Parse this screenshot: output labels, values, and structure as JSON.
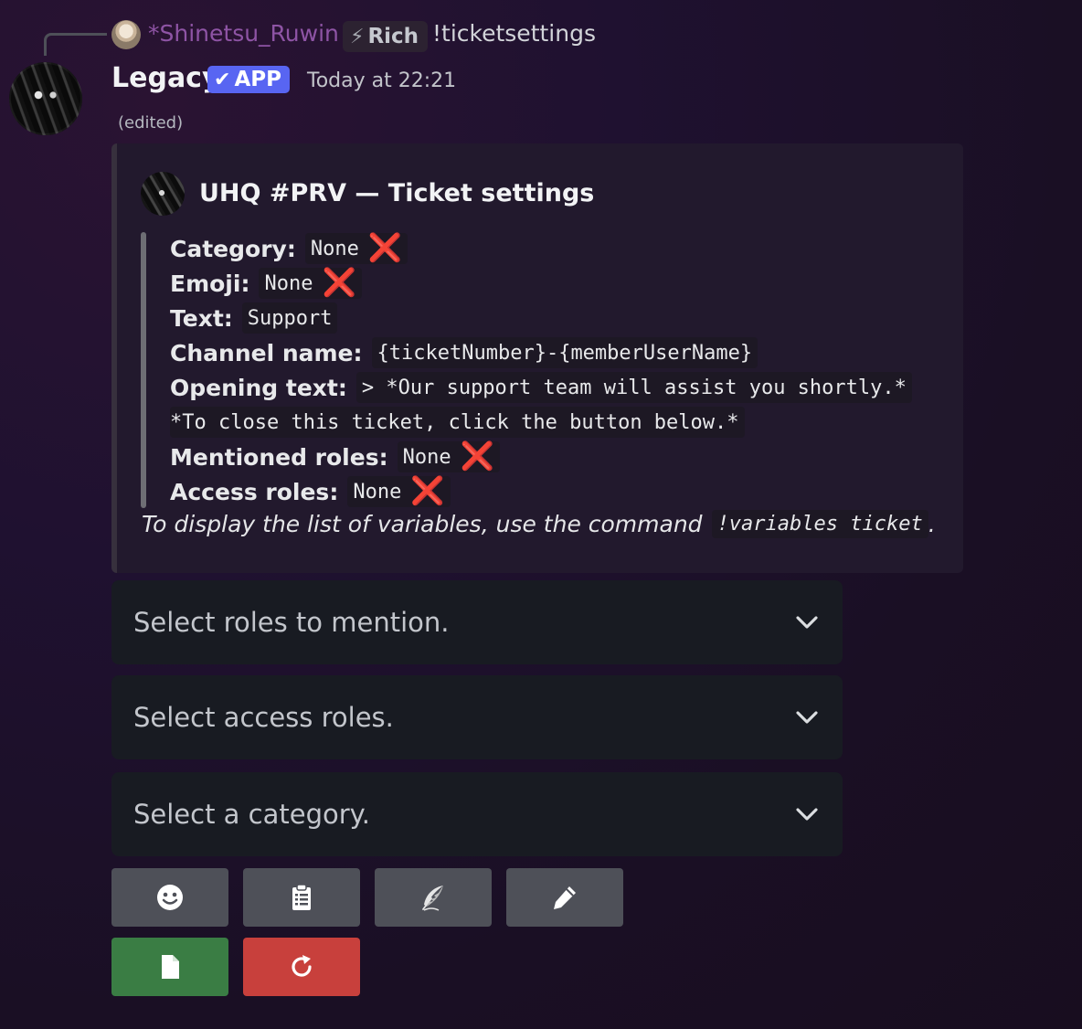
{
  "reply": {
    "username": "*Shinetsu_Ruwin",
    "tag": "Rich",
    "command": "!ticketsettings"
  },
  "message": {
    "author": "Legacy",
    "badge": "APP",
    "timestamp": "Today at 22:21",
    "edited": "(edited)"
  },
  "embed": {
    "title": "UHQ #PRV — Ticket settings",
    "fields": [
      {
        "label": "Category:",
        "value": "None",
        "x_mark": "❌"
      },
      {
        "label": "Emoji:",
        "value": "None",
        "x_mark": "❌"
      },
      {
        "label": "Text:",
        "value": "Support"
      },
      {
        "label": "Channel name:",
        "value": "{ticketNumber}-{memberUserName}"
      },
      {
        "label": "Opening text:",
        "value": "> *Our support team will assist you shortly.*"
      },
      {
        "label": "",
        "value": "*To close this ticket, click the button below.*"
      },
      {
        "label": "Mentioned roles:",
        "value": "None",
        "x_mark": "❌"
      },
      {
        "label": "Access roles:",
        "value": "None",
        "x_mark": "❌"
      }
    ],
    "footer_text": "To display the list of variables, use the command",
    "footer_code": "!variables ticket",
    "footer_end": "."
  },
  "selects": [
    {
      "placeholder": "Select roles to mention."
    },
    {
      "placeholder": "Select access roles."
    },
    {
      "placeholder": "Select a category."
    }
  ],
  "buttons": {
    "row1": [
      {
        "icon": "smiley-icon",
        "color": "#4e5058"
      },
      {
        "icon": "clipboard-icon",
        "color": "#4e5058"
      },
      {
        "icon": "feather-icon",
        "color": "#4e5058"
      },
      {
        "icon": "pencil-icon",
        "color": "#4e5058"
      }
    ],
    "row2": [
      {
        "icon": "document-icon",
        "color": "#3a7d44"
      },
      {
        "icon": "refresh-icon",
        "color": "#c8403c"
      }
    ]
  },
  "colors": {
    "reply_username": "#8e54a5",
    "app_badge": "#5865f2",
    "x_mark": "#e0292f"
  }
}
